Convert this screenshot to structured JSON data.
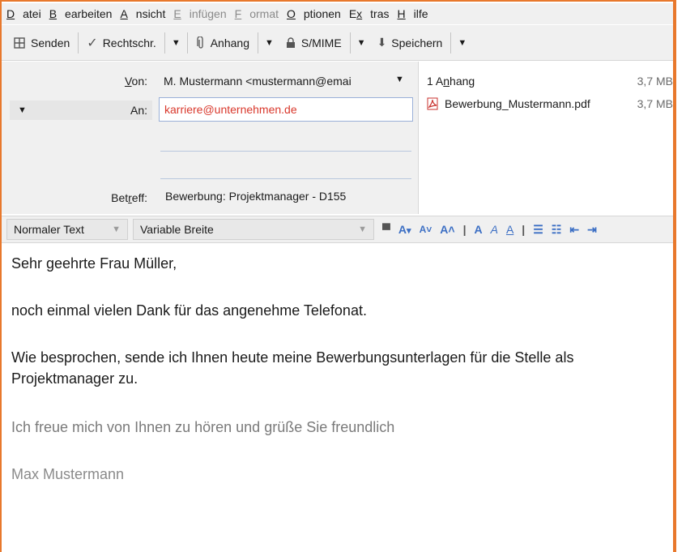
{
  "menu": {
    "items": [
      {
        "label": "Datei",
        "disabled": false
      },
      {
        "label": "Bearbeiten",
        "disabled": false
      },
      {
        "label": "Ansicht",
        "disabled": false
      },
      {
        "label": "Einfügen",
        "disabled": true
      },
      {
        "label": "Format",
        "disabled": true
      },
      {
        "label": "Optionen",
        "disabled": false
      },
      {
        "label": "Extras",
        "disabled": false
      },
      {
        "label": "Hilfe",
        "disabled": false
      }
    ]
  },
  "toolbar": {
    "send_label": "Senden",
    "spell_label": "Rechtschr.",
    "attach_label": "Anhang",
    "smime_label": "S/MIME",
    "save_label": "Speichern"
  },
  "header": {
    "from_label": "Von:",
    "from_value": "M. Mustermann <mustermann@emai",
    "to_label": "An:",
    "to_value": "karriere@unternehmen.de",
    "subject_label": "Betreff:",
    "subject_value": "Bewerbung: Projektmanager - D155"
  },
  "attachments": {
    "header_label": "1 Anhang",
    "total_size": "3,7 MB",
    "files": [
      {
        "name": "Bewerbung_Mustermann.pdf",
        "size": "3,7 MB"
      }
    ]
  },
  "format": {
    "paragraph_style": "Normaler Text",
    "font": "Variable Breite"
  },
  "body": {
    "greeting": "Sehr geehrte Frau Müller,",
    "line1": "noch einmal vielen Dank für das angenehme Telefonat.",
    "line2": "Wie besprochen, sende ich Ihnen heute meine Bewerbungsunterlagen für die Stelle als Projektmanager zu.",
    "closing": "Ich freue mich von Ihnen zu hören und grüße Sie freundlich",
    "signature": "Max Mustermann"
  },
  "colors": {
    "accent_frame": "#e8782c",
    "recipient_text": "#d9382c",
    "format_icons": "#3c6fc4"
  }
}
